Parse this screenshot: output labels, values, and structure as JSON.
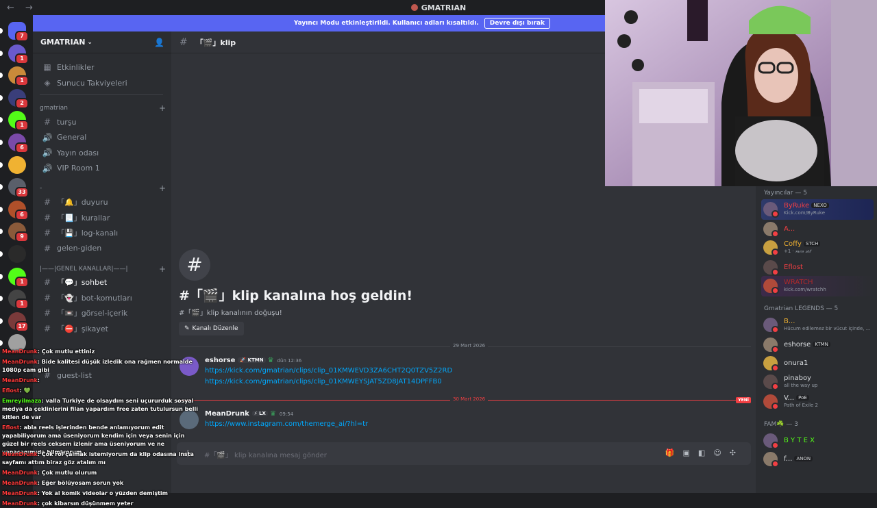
{
  "window": {
    "title": "GMATRIAN",
    "nav": "← →"
  },
  "banner": {
    "text": "Yayıncı Modu etkinleştirildi. Kullanıcı adları kısaltıldı.",
    "button": "Devre dışı bırak"
  },
  "rail": {
    "servers": [
      {
        "badge": "7",
        "color": "#5865f2",
        "icon": "discord-logo-icon"
      },
      {
        "badge": "1",
        "color": "#6a5acd"
      },
      {
        "badge": "1",
        "color": "#c98a3a"
      },
      {
        "badge": "2",
        "color": "#3a3e7a"
      },
      {
        "badge": "1",
        "color": "#53fc18",
        "icon": "kick-logo-icon"
      },
      {
        "badge": "6",
        "color": "#7a4aa8"
      },
      {
        "badge": "",
        "color": "#f0b232"
      },
      {
        "badge": "33",
        "color": "#5a5f6a"
      },
      {
        "badge": "6",
        "color": "#b0502a"
      },
      {
        "badge": "9",
        "color": "#8a5a3a"
      },
      {
        "badge": "",
        "color": "#2a2a2a"
      },
      {
        "badge": "1",
        "color": "#53fc18",
        "icon": "kick-logo-icon"
      },
      {
        "badge": "1",
        "color": "#444"
      },
      {
        "badge": "17",
        "color": "#7a3a3a"
      },
      {
        "badge": "",
        "color": "#a0a0a0"
      }
    ]
  },
  "sidebar": {
    "server_name": "GMATRIAN",
    "top_items": [
      {
        "label": "Etkinlikler",
        "icon": "calendar-icon"
      },
      {
        "label": "Sunucu Takviyeleri",
        "icon": "boost-icon"
      }
    ],
    "cat1": "gmatrian",
    "cat1_items": [
      {
        "label": "turşu",
        "icon": "#"
      },
      {
        "label": "General",
        "icon": "🔊"
      },
      {
        "label": "Yayın odası",
        "icon": "🔊"
      },
      {
        "label": "VIP Room 1",
        "icon": "🔊"
      }
    ],
    "cat2": "-",
    "cat2_items": [
      {
        "label": "「🔔」duyuru",
        "icon": "#"
      },
      {
        "label": "「📃」kurallar",
        "icon": "#"
      },
      {
        "label": "「💾」log-kanalı",
        "icon": "#"
      },
      {
        "label": "gelen-giden",
        "icon": "#"
      }
    ],
    "cat3": "|——|GENEL KANALLAR|——|",
    "cat3_items": [
      {
        "label": "「💬」sohbet",
        "icon": "#",
        "active": true
      },
      {
        "label": "「👻」bot-komutları",
        "icon": "#"
      },
      {
        "label": "「📼」görsel-içerik",
        "icon": "#"
      },
      {
        "label": "「⛔」şikayet",
        "icon": "#"
      }
    ],
    "guest_list": "guest-list"
  },
  "chat": {
    "channel": "「🎬」klip",
    "welcome_title": "#「🎬」klip kanalına hoş geldin!",
    "welcome_sub": "#「🎬」klip kanalının doğuşu!",
    "edit_button": "Kanalı Düzenle",
    "divider1": "29 Mart 2026",
    "divider2": "30 Mart 2026",
    "new_tag": "YENİ",
    "messages": [
      {
        "author": "eshorse",
        "tag": "KTMN",
        "time": "dün 12:36",
        "color": "#7a5ac8",
        "links": [
          "https://kick.com/gmatrian/clips/clip_01KMWEVD3ZA6CHT2Q0TZV5Z2RD",
          "https://kick.com/gmatrian/clips/clip_01KMWEYSJAT5ZD8JAT14DPFFB0"
        ]
      },
      {
        "author": "MeanDrunk",
        "tag": "LX",
        "time": "09:54",
        "color": "#5a6a7a",
        "links": [
          "https://www.instagram.com/themerge_ai/?hl=tr"
        ]
      }
    ],
    "composer_placeholder": "klip kanalına mesaj gönder",
    "composer_prefix": "#「🎬」"
  },
  "members": {
    "groups": [
      {
        "title": "Yayıncılar — 5",
        "items": [
          {
            "name": "ByRuke",
            "tag": "NEXO",
            "sub": "Kick.com/ByRuke",
            "color": "#f23f43",
            "hl": "hl"
          },
          {
            "name": "A...",
            "tag": "",
            "sub": "",
            "color": "#f23f43"
          },
          {
            "name": "Coffy",
            "tag": "STCH",
            "sub": "+1 · 𝓂𝒾𝓃 𝓈𝑒𝓉",
            "color": "#f0b232"
          },
          {
            "name": "Eflost",
            "tag": "",
            "sub": "",
            "color": "#f23f43"
          },
          {
            "name": "WRATCH",
            "tag": "",
            "sub": "kick.com/wratchh",
            "color": "#b02a2a",
            "hl": "hl2"
          }
        ]
      },
      {
        "title": "Gmatrian LEGENDS — 5",
        "items": [
          {
            "name": "B...",
            "tag": "",
            "sub": "Hücum edilemez bir vücut içinde, ...",
            "color": "#f0b232"
          },
          {
            "name": "eshorse",
            "tag": "KTMN",
            "sub": "",
            "color": "#dbdee1"
          },
          {
            "name": "onura1",
            "tag": "",
            "sub": "",
            "color": "#dbdee1"
          },
          {
            "name": "pinaboy",
            "tag": "",
            "sub": "all the way up",
            "color": "#dbdee1"
          },
          {
            "name": "V...",
            "tag": "PoE",
            "sub": "Path of Exile 2",
            "color": "#dbdee1"
          }
        ]
      },
      {
        "title": "FAM☘️ — 3",
        "items": [
          {
            "name": "B Y T E X",
            "tag": "",
            "sub": "",
            "color": "#53fc18"
          },
          {
            "name": "f...",
            "tag": "ANON",
            "sub": "",
            "color": "#dbdee1"
          }
        ]
      }
    ]
  },
  "stream_chat": [
    {
      "user": "MeanDrunk",
      "text": ": Çok mutlu ettiniz",
      "green": false
    },
    {
      "user": "MeanDrunk",
      "text": ": Bide kalitesi düşük izledik ona rağmen normalde 1080p cam gibi",
      "green": false
    },
    {
      "user": "MeanDrunk",
      "text": ":",
      "green": false
    },
    {
      "user": "Eflost",
      "text": ": 💚",
      "green": false
    },
    {
      "user": "Emreyilmaza",
      "text": ": valla Turkiye de olsaydım seni uçururduk sosyal medya da çeklinlerini filan yapardım free zaten tutulursun belli kitlen de var",
      "green": true
    },
    {
      "user": "Eflost",
      "text": ": abla reels işlerinden bende anlamıyorum edit yapabiliyorum ama üseniyorum kendim için veya senin için güzel bir reels ceksem izlenir ama üseniyorum ve ne yapacagımıda bilmiyorum",
      "green": false
    },
    {
      "user": "MeanDrunk",
      "text": ": Çok rol çalmak istemiyorum da klip odasına insta sayfamı attım biraz göz atalım mı",
      "green": false
    },
    {
      "user": "MeanDrunk",
      "text": ": Çok mutlu olurum",
      "green": false
    },
    {
      "user": "MeanDrunk",
      "text": ": Eğer bölüyosam sorun yok",
      "green": false
    },
    {
      "user": "MeanDrunk",
      "text": ": Yok al komik videolar o yüzden demiştim",
      "green": false
    },
    {
      "user": "MeanDrunk",
      "text": ": çok kibarsın düşünmem yeter",
      "green": false
    }
  ]
}
